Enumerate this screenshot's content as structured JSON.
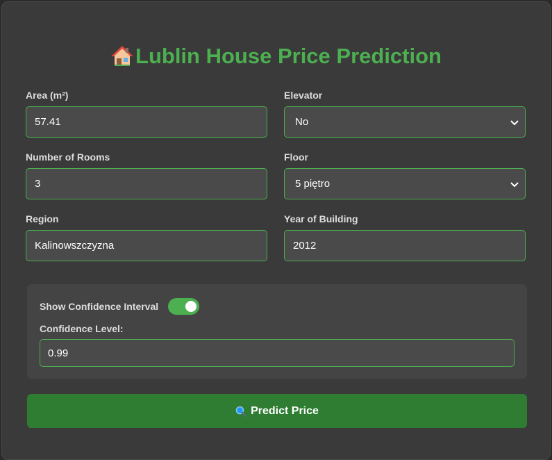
{
  "title": "Lublin House Price Prediction",
  "fields": {
    "area": {
      "label": "Area (m²)",
      "value": "57.41"
    },
    "elevator": {
      "label": "Elevator",
      "value": "No"
    },
    "rooms": {
      "label": "Number of Rooms",
      "value": "3"
    },
    "floor": {
      "label": "Floor",
      "value": "5 piętro"
    },
    "region": {
      "label": "Region",
      "value": "Kalinowszczyzna"
    },
    "year": {
      "label": "Year of Building",
      "value": "2012"
    }
  },
  "confidence": {
    "toggle_label": "Show Confidence Interval",
    "toggle_on": true,
    "level_label": "Confidence Level:",
    "level_value": "0.99"
  },
  "predict_button": {
    "label": "Predict Price",
    "icon": "magnifier-icon"
  },
  "colors": {
    "accent": "#4caf50",
    "button": "#2e7d32",
    "card": "#3a3a3a",
    "input_bg": "#4a4a4a"
  }
}
